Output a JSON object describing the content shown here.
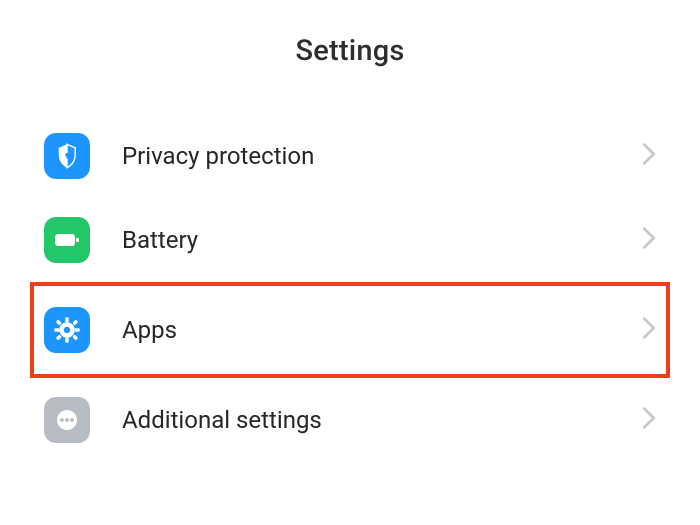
{
  "header": {
    "title": "Settings"
  },
  "items": [
    {
      "id": "privacy",
      "label": "Privacy protection",
      "highlighted": false
    },
    {
      "id": "battery",
      "label": "Battery",
      "highlighted": false
    },
    {
      "id": "apps",
      "label": "Apps",
      "highlighted": true
    },
    {
      "id": "additional",
      "label": "Additional settings",
      "highlighted": false
    }
  ]
}
